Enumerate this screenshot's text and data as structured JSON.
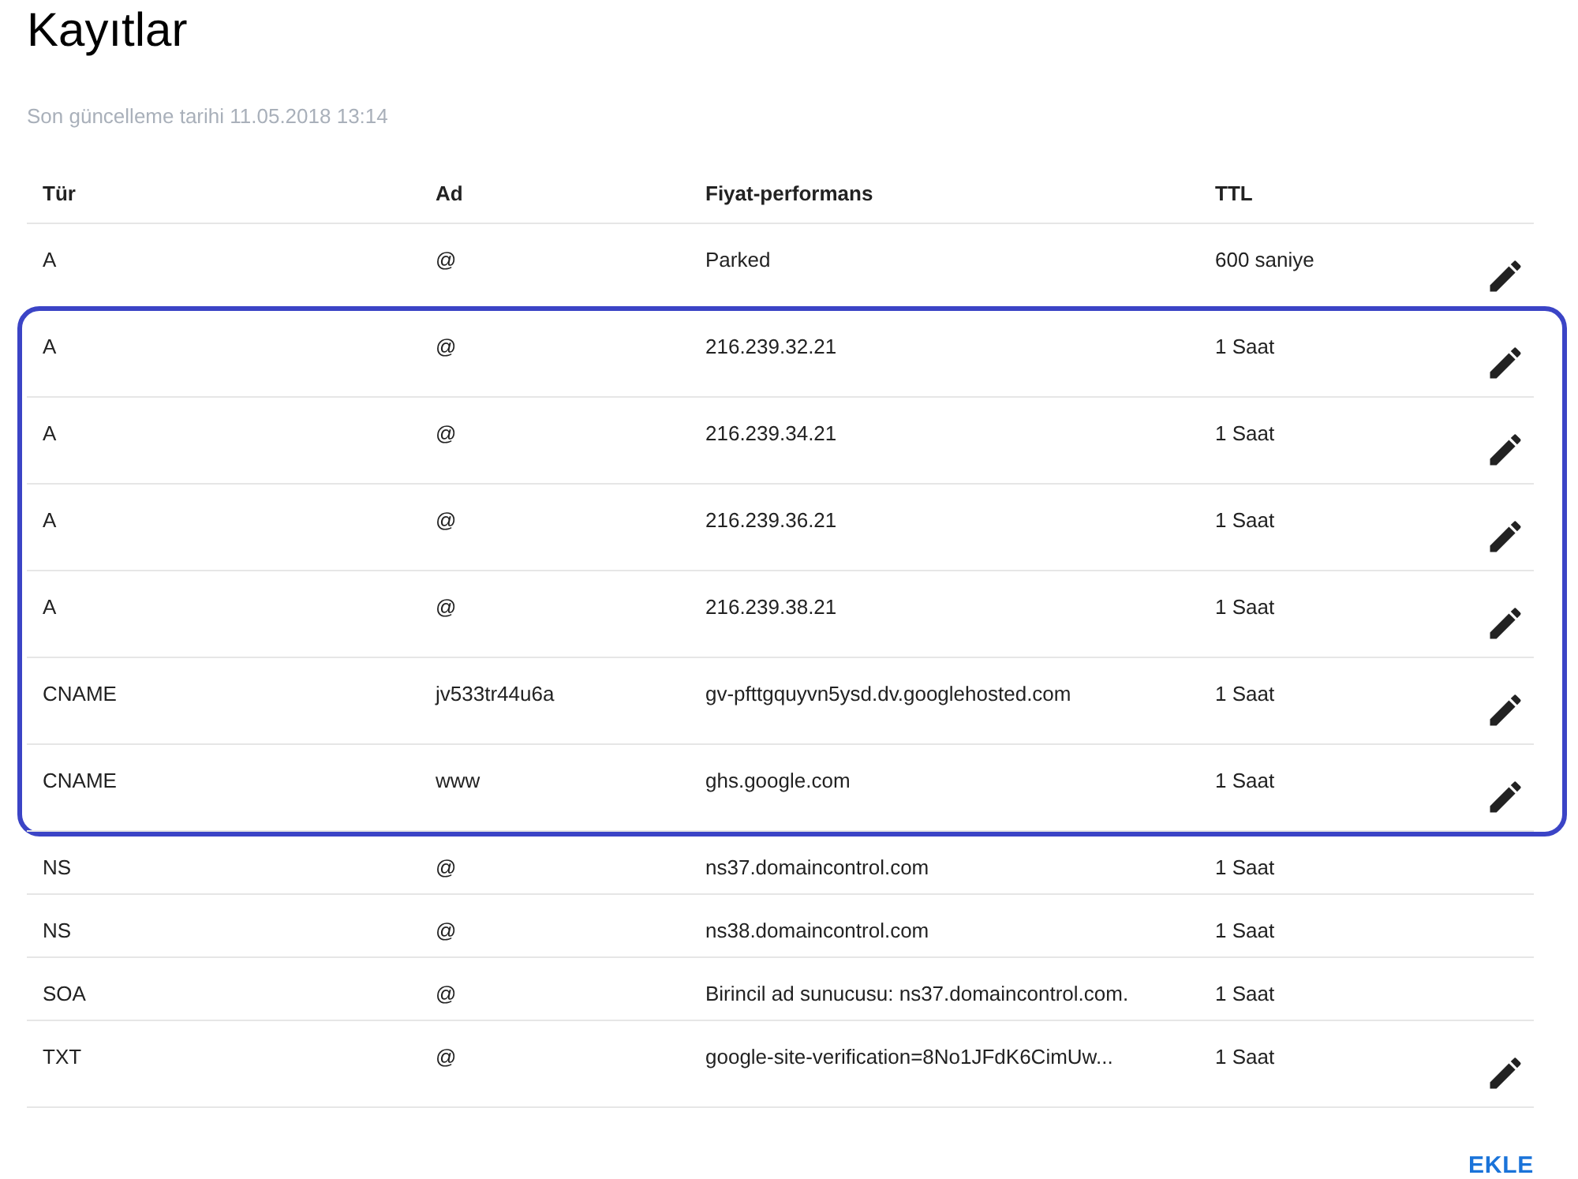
{
  "title": "Kayıtlar",
  "last_updated": "Son güncelleme tarihi 11.05.2018 13:14",
  "table": {
    "columns": [
      "Tür",
      "Ad",
      "Fiyat-performans",
      "TTL"
    ],
    "row_groups": [
      {
        "highlighted": false,
        "rows": [
          {
            "cells": [
              "A",
              "@",
              "Parked",
              "600 saniye"
            ],
            "editable": true
          }
        ]
      },
      {
        "highlighted": true,
        "rows": [
          {
            "cells": [
              "A",
              "@",
              "216.239.32.21",
              "1 Saat"
            ],
            "editable": true
          },
          {
            "cells": [
              "A",
              "@",
              "216.239.34.21",
              "1 Saat"
            ],
            "editable": true
          },
          {
            "cells": [
              "A",
              "@",
              "216.239.36.21",
              "1 Saat"
            ],
            "editable": true
          },
          {
            "cells": [
              "A",
              "@",
              "216.239.38.21",
              "1 Saat"
            ],
            "editable": true
          },
          {
            "cells": [
              "CNAME",
              "jv533tr44u6a",
              "gv-pfttgquyvn5ysd.dv.googlehosted.com",
              "1 Saat"
            ],
            "editable": true
          },
          {
            "cells": [
              "CNAME",
              "www",
              "ghs.google.com",
              "1 Saat"
            ],
            "editable": true
          }
        ]
      },
      {
        "highlighted": false,
        "rows": [
          {
            "cells": [
              "NS",
              "@",
              "ns37.domaincontrol.com",
              "1 Saat"
            ],
            "editable": false
          },
          {
            "cells": [
              "NS",
              "@",
              "ns38.domaincontrol.com",
              "1 Saat"
            ],
            "editable": false
          },
          {
            "cells": [
              "SOA",
              "@",
              "Birincil ad sunucusu: ns37.domaincontrol.com.",
              "1 Saat"
            ],
            "editable": false
          },
          {
            "cells": [
              "TXT",
              "@",
              "google-site-verification=8No1JFdK6CimUw...",
              "1 Saat"
            ],
            "editable": true
          }
        ]
      }
    ]
  },
  "add_button": "EKLE"
}
